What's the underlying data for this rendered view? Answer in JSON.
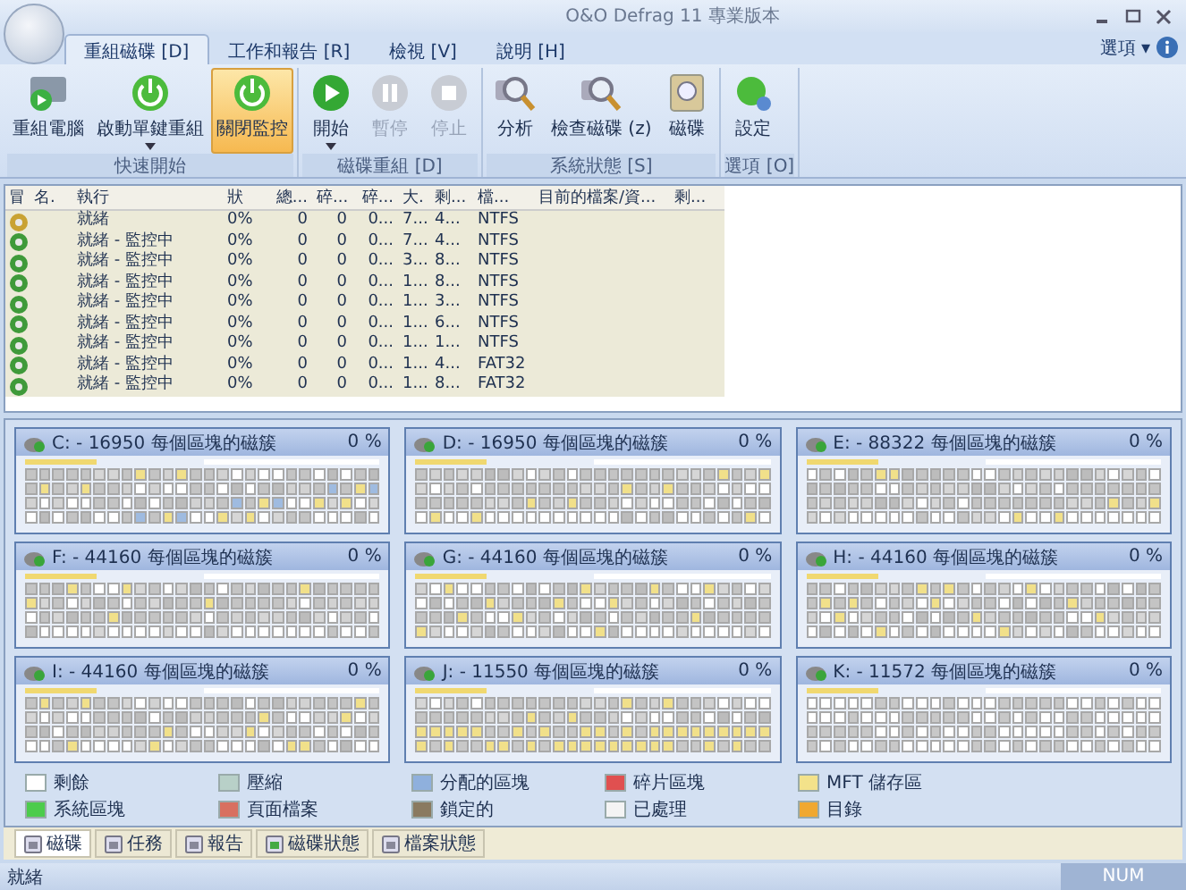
{
  "window": {
    "title": "O&O Defrag 11 專業版本"
  },
  "ribbon_tabs": [
    {
      "label": "重組磁碟 [D]",
      "selected": true
    },
    {
      "label": "工作和報告 [R]",
      "selected": false
    },
    {
      "label": "檢視 [V]",
      "selected": false
    },
    {
      "label": "說明 [H]",
      "selected": false
    }
  ],
  "options_menu": {
    "label": "選項",
    "caret": "▾"
  },
  "ribbon_groups": [
    {
      "label": "快速開始",
      "buttons": [
        {
          "label": "重組電腦",
          "disabled": false,
          "pressed": false,
          "dropdown": false
        },
        {
          "label": "啟動單鍵重組",
          "disabled": false,
          "pressed": false,
          "dropdown": true
        },
        {
          "label": "關閉監控",
          "disabled": false,
          "pressed": true,
          "dropdown": false
        }
      ]
    },
    {
      "label": "磁碟重組 [D]",
      "buttons": [
        {
          "label": "開始",
          "disabled": false,
          "pressed": false,
          "dropdown": true
        },
        {
          "label": "暫停",
          "disabled": true,
          "pressed": false,
          "dropdown": false
        },
        {
          "label": "停止",
          "disabled": true,
          "pressed": false,
          "dropdown": false
        }
      ]
    },
    {
      "label": "系統狀態 [S]",
      "buttons": [
        {
          "label": "分析",
          "disabled": false,
          "pressed": false,
          "dropdown": false
        },
        {
          "label": "檢查磁碟 (z)",
          "disabled": false,
          "pressed": false,
          "dropdown": false
        },
        {
          "label": "磁碟",
          "disabled": false,
          "pressed": false,
          "dropdown": false
        }
      ]
    },
    {
      "label": "選項 [O]",
      "buttons": [
        {
          "label": "設定",
          "disabled": false,
          "pressed": false,
          "dropdown": false
        }
      ]
    }
  ],
  "table": {
    "columns": [
      "冒",
      "名.",
      "執行",
      "狀",
      "總...",
      "碎...",
      "碎...",
      "大.",
      "剩...",
      "檔...",
      "目前的檔案/資...",
      "剩..."
    ],
    "rows": [
      {
        "color": "#c9a233",
        "cells": [
          "",
          "",
          "就緒",
          "0%",
          "0",
          "0",
          "0...",
          "7...",
          "4...",
          "NTFS",
          "",
          ""
        ]
      },
      {
        "color": "#3f9a3a",
        "cells": [
          "",
          "",
          "就緒 - 監控中",
          "0%",
          "0",
          "0",
          "0...",
          "7...",
          "4...",
          "NTFS",
          "",
          ""
        ]
      },
      {
        "color": "#3f9a3a",
        "cells": [
          "",
          "",
          "就緒 - 監控中",
          "0%",
          "0",
          "0",
          "0...",
          "3...",
          "8...",
          "NTFS",
          "",
          ""
        ]
      },
      {
        "color": "#3f9a3a",
        "cells": [
          "",
          "",
          "就緒 - 監控中",
          "0%",
          "0",
          "0",
          "0...",
          "1...",
          "8...",
          "NTFS",
          "",
          ""
        ]
      },
      {
        "color": "#3f9a3a",
        "cells": [
          "",
          "",
          "就緒 - 監控中",
          "0%",
          "0",
          "0",
          "0...",
          "1...",
          "3...",
          "NTFS",
          "",
          ""
        ]
      },
      {
        "color": "#3f9a3a",
        "cells": [
          "",
          "",
          "就緒 - 監控中",
          "0%",
          "0",
          "0",
          "0...",
          "1...",
          "6...",
          "NTFS",
          "",
          ""
        ]
      },
      {
        "color": "#3f9a3a",
        "cells": [
          "",
          "",
          "就緒 - 監控中",
          "0%",
          "0",
          "0",
          "0...",
          "1...",
          "1...",
          "NTFS",
          "",
          ""
        ]
      },
      {
        "color": "#3f9a3a",
        "cells": [
          "",
          "",
          "就緒 - 監控中",
          "0%",
          "0",
          "0",
          "0...",
          "1...",
          "4...",
          "FAT32",
          "",
          ""
        ]
      },
      {
        "color": "#3f9a3a",
        "cells": [
          "",
          "",
          "就緒 - 監控中",
          "0%",
          "0",
          "0",
          "0...",
          "1...",
          "8...",
          "FAT32",
          "",
          ""
        ]
      }
    ]
  },
  "drives": [
    {
      "title": "C: - 16950 每個區塊的磁簇",
      "percent": "0 %"
    },
    {
      "title": "D: - 16950 每個區塊的磁簇",
      "percent": "0 %"
    },
    {
      "title": "E: - 88322 每個區塊的磁簇",
      "percent": "0 %"
    },
    {
      "title": "F: - 44160 每個區塊的磁簇",
      "percent": "0 %"
    },
    {
      "title": "G: - 44160 每個區塊的磁簇",
      "percent": "0 %"
    },
    {
      "title": "H: - 44160 每個區塊的磁簇",
      "percent": "0 %"
    },
    {
      "title": "I: - 44160 每個區塊的磁簇",
      "percent": "0 %"
    },
    {
      "title": "J: - 11550 每個區塊的磁簇",
      "percent": "0 %"
    },
    {
      "title": "K: - 11572 每個區塊的磁簇",
      "percent": "0 %"
    }
  ],
  "legend": [
    {
      "label": "剩餘",
      "color": "#ffffff"
    },
    {
      "label": "壓縮",
      "color": "#b8d0c8"
    },
    {
      "label": "分配的區塊",
      "color": "#8fb0dd"
    },
    {
      "label": "碎片區塊",
      "color": "#e05050"
    },
    {
      "label": "MFT 儲存區",
      "color": "#f3e28a"
    },
    {
      "label": "系統區塊",
      "color": "#4ccc4c"
    },
    {
      "label": "頁面檔案",
      "color": "#d87060"
    },
    {
      "label": "鎖定的",
      "color": "#8a7a60"
    },
    {
      "label": "已處理",
      "color": "#f4f4f4"
    },
    {
      "label": "目錄",
      "color": "#f0a830"
    }
  ],
  "bottom_tabs": [
    {
      "label": "磁碟",
      "selected": true
    },
    {
      "label": "任務",
      "selected": false
    },
    {
      "label": "報告",
      "selected": false
    },
    {
      "label": "磁碟狀態",
      "selected": false
    },
    {
      "label": "檔案狀態",
      "selected": false
    }
  ],
  "status_bar": {
    "text": "就緒",
    "num": "NUM"
  }
}
